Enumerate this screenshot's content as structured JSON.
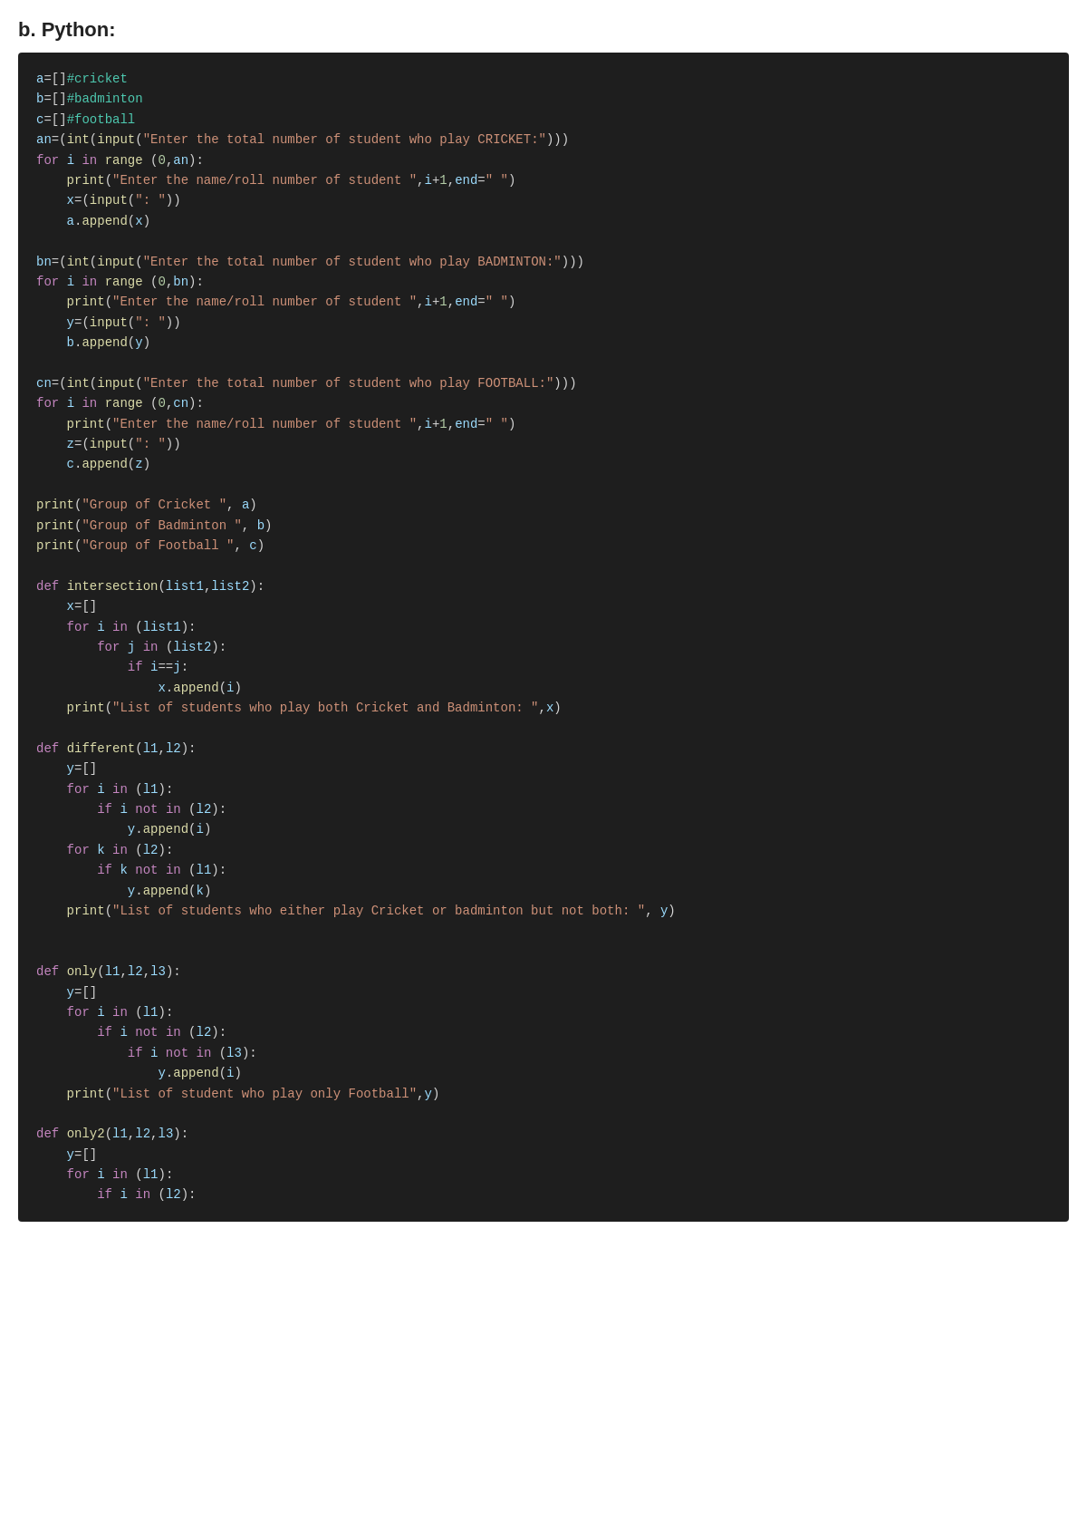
{
  "page": {
    "title": "b. Python:"
  }
}
